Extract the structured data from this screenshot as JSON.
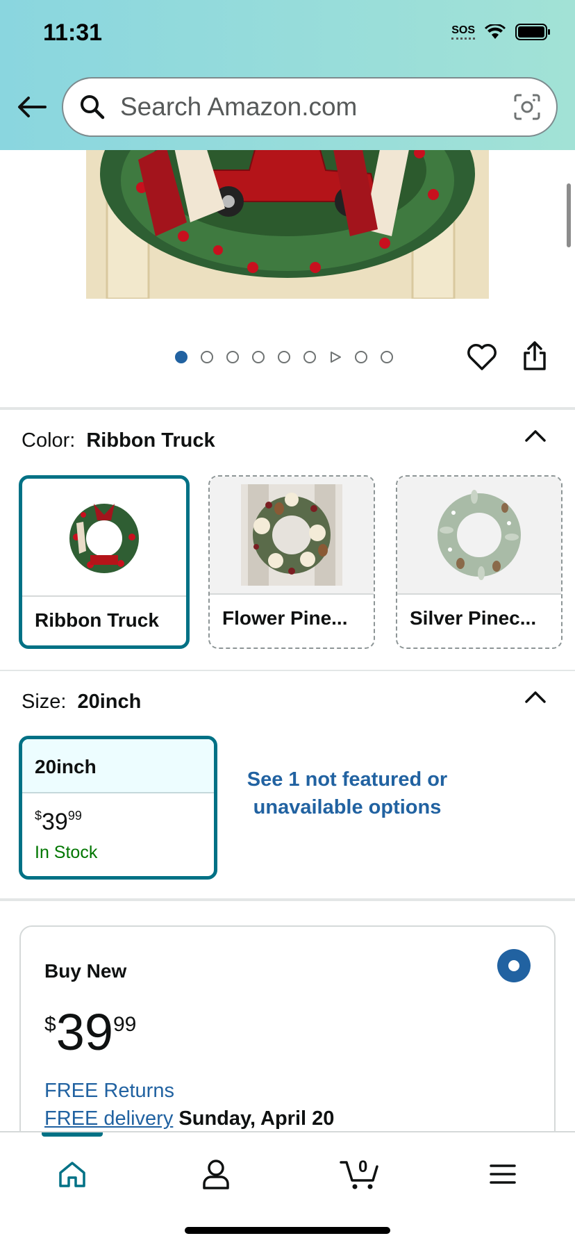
{
  "status_bar": {
    "time": "11:31",
    "sos": "SOS"
  },
  "search": {
    "placeholder": "Search Amazon.com"
  },
  "gallery": {
    "image_count": 9,
    "active_index": 0,
    "video_index": 6
  },
  "color": {
    "label": "Color:",
    "selected": "Ribbon Truck",
    "options": [
      {
        "name": "Ribbon Truck"
      },
      {
        "name": "Flower Pine..."
      },
      {
        "name": "Silver Pinec..."
      }
    ]
  },
  "size": {
    "label": "Size:",
    "selected": "20inch",
    "card": {
      "title": "20inch",
      "price_symbol": "$",
      "price_whole": "39",
      "price_fraction": "99",
      "stock": "In Stock"
    },
    "see_more": "See 1 not featured or unavailable options"
  },
  "buy_box": {
    "title": "Buy New",
    "price_symbol": "$",
    "price_whole": "39",
    "price_fraction": "99",
    "returns": "FREE Returns",
    "delivery_link": "FREE delivery",
    "delivery_date": "Sunday, April 20"
  },
  "tabbar": {
    "cart_count": "0"
  },
  "colors": {
    "accent": "#007185",
    "link": "#2162a1",
    "stock": "#007600"
  }
}
